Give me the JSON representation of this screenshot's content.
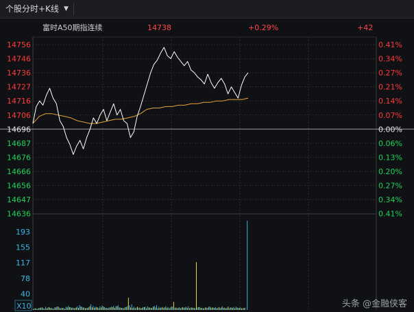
{
  "tab": {
    "label": "个股分时+K线",
    "dropdown_icon": "caret-down-icon"
  },
  "header": {
    "name": "富时A50期指连续",
    "price": "14738",
    "change_pct": "+0.29%",
    "change": "+42"
  },
  "colors": {
    "up": "#ff3b3b",
    "down": "#1ed35a",
    "flat": "#e6e6e6",
    "price_line": "#ffffff",
    "avg_line": "#e8a53a",
    "header_price": "#ff4545",
    "vol_axis": "#39b6ea",
    "vol_up": "#36b3e3",
    "vol_down": "#e3d95a",
    "grid": "#2a2a2e"
  },
  "price_axis": {
    "left": [
      "14756",
      "14746",
      "14736",
      "14727",
      "14716",
      "14706",
      "14696",
      "14687",
      "14676",
      "14666",
      "14656",
      "14647",
      "14636"
    ],
    "right": [
      "0.41%",
      "0.34%",
      "0.27%",
      "0.21%",
      "0.14%",
      "0.07%",
      "0.00%",
      "0.06%",
      "0.13%",
      "0.20%",
      "0.27%",
      "0.34%",
      "0.41%"
    ]
  },
  "volume_axis": {
    "labels": [
      "193",
      "155",
      "117",
      "78",
      "40"
    ],
    "unit": "X10"
  },
  "chart_data": {
    "type": "line",
    "y_prev_close": 14696,
    "ylim": [
      14636,
      14756
    ],
    "price": [
      14700,
      14712,
      14716,
      14713,
      14720,
      14725,
      14718,
      14714,
      14702,
      14698,
      14690,
      14685,
      14678,
      14684,
      14688,
      14682,
      14690,
      14696,
      14704,
      14700,
      14706,
      14710,
      14702,
      14708,
      14714,
      14706,
      14710,
      14702,
      14700,
      14690,
      14694,
      14705,
      14712,
      14720,
      14728,
      14736,
      14742,
      14745,
      14750,
      14754,
      14748,
      14746,
      14751,
      14747,
      14744,
      14741,
      14744,
      14738,
      14736,
      14733,
      14731,
      14728,
      14735,
      14729,
      14725,
      14729,
      14732,
      14728,
      14721,
      14726,
      14722,
      14718,
      14727,
      14733,
      14736
    ],
    "avg": [
      14700,
      14705,
      14707,
      14707,
      14706,
      14705,
      14704,
      14702,
      14701,
      14700,
      14700,
      14701,
      14702,
      14703,
      14703,
      14704,
      14705,
      14707,
      14710,
      14711,
      14711,
      14712,
      14712,
      14713,
      14713,
      14714,
      14714,
      14715,
      14715,
      14716,
      14716,
      14717,
      14717,
      14717,
      14718
    ],
    "volume": {
      "up": [
        4,
        3,
        5,
        6,
        4,
        8,
        6,
        5,
        3,
        7,
        9,
        6,
        5,
        4,
        8,
        10,
        7,
        6,
        5,
        9,
        12,
        8,
        6,
        5,
        7,
        14,
        10,
        8,
        6,
        9,
        11,
        7,
        5,
        6,
        8,
        10,
        9,
        12,
        6,
        5,
        7,
        9,
        11,
        14,
        8,
        6,
        5,
        4,
        7,
        8,
        9,
        6,
        5,
        10,
        12,
        8,
        6,
        5,
        9,
        7,
        6,
        8,
        5,
        4,
        7,
        6,
        5,
        8,
        9,
        6,
        5,
        4,
        6,
        7,
        5,
        4,
        6,
        8,
        5,
        6,
        7,
        5,
        4,
        9,
        6,
        5,
        4,
        6,
        7,
        8,
        5,
        6,
        4,
        5,
        220
      ],
      "down": [
        2,
        4,
        3,
        5,
        6,
        3,
        4,
        7,
        5,
        3,
        6,
        8,
        4,
        5,
        3,
        6,
        7,
        5,
        4,
        6,
        5,
        8,
        6,
        4,
        5,
        9,
        6,
        5,
        7,
        4,
        6,
        8,
        5,
        4,
        6,
        7,
        5,
        9,
        6,
        5,
        4,
        7,
        30,
        6,
        5,
        4,
        8,
        6,
        5,
        7,
        4,
        6,
        5,
        8,
        6,
        4,
        5,
        7,
        6,
        5,
        4,
        8,
        20,
        6,
        5,
        4,
        7,
        6,
        5,
        4,
        6,
        5,
        118,
        7,
        5,
        4,
        6,
        5,
        8,
        6,
        5,
        4,
        7,
        6,
        5,
        4,
        8,
        6,
        5,
        4,
        6,
        5,
        4,
        5,
        0
      ]
    }
  },
  "watermark": "头条 @金融侠客"
}
